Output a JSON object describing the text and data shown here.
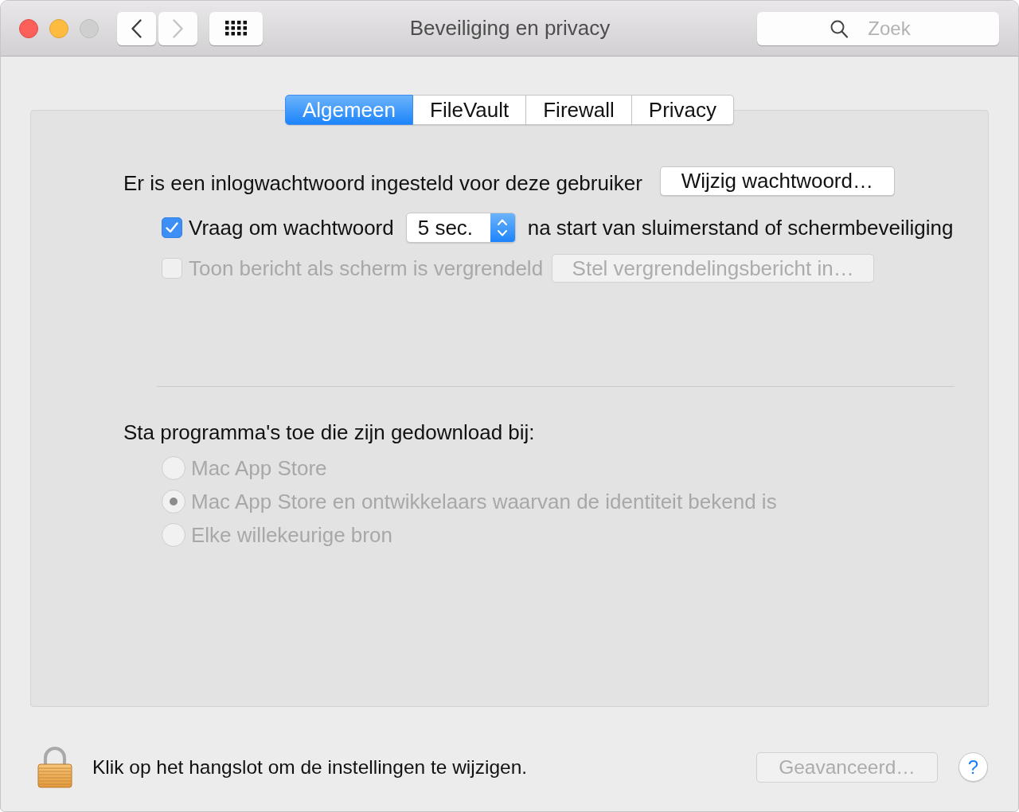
{
  "window": {
    "title": "Beveiliging en privacy",
    "traffic_lights": [
      {
        "kind": "close",
        "disabled": false
      },
      {
        "kind": "minimize",
        "disabled": false
      },
      {
        "kind": "zoom",
        "disabled": true
      }
    ]
  },
  "toolbar": {
    "back": {
      "disabled": false
    },
    "forward": {
      "disabled": true
    },
    "search": {
      "placeholder": "Zoek"
    }
  },
  "tabs": [
    {
      "label": "Algemeen",
      "selected": true
    },
    {
      "label": "FileVault",
      "selected": false
    },
    {
      "label": "Firewall",
      "selected": false
    },
    {
      "label": "Privacy",
      "selected": false
    }
  ],
  "password": {
    "label": "Er is een inlogwachtwoord ingesteld voor deze gebruiker",
    "button": {
      "label": "Wijzig wachtwoord…",
      "disabled": false
    }
  },
  "require_password": {
    "checked": true,
    "disabled": false,
    "label": "Vraag om wachtwoord",
    "delay": "5 sec.",
    "suffix": "na start van sluimerstand of schermbeveiliging"
  },
  "lock_message": {
    "checked": false,
    "disabled": true,
    "label": "Toon bericht als scherm is vergrendeld",
    "button": {
      "label": "Stel vergrendelingsbericht in…",
      "disabled": true
    }
  },
  "downloads": {
    "heading": "Sta programma's toe die zijn gedownload bij:",
    "options": [
      {
        "label": "Mac App Store",
        "selected": false,
        "disabled": true
      },
      {
        "label": "Mac App Store en ontwikkelaars waarvan de identiteit bekend is",
        "selected": true,
        "disabled": true
      },
      {
        "label": "Elke willekeurige bron",
        "selected": false,
        "disabled": true
      }
    ]
  },
  "footer": {
    "lock_text": "Klik op het hangslot om de instellingen te wijzigen.",
    "advanced": {
      "label": "Geavanceerd…",
      "disabled": true
    },
    "help": "?"
  }
}
